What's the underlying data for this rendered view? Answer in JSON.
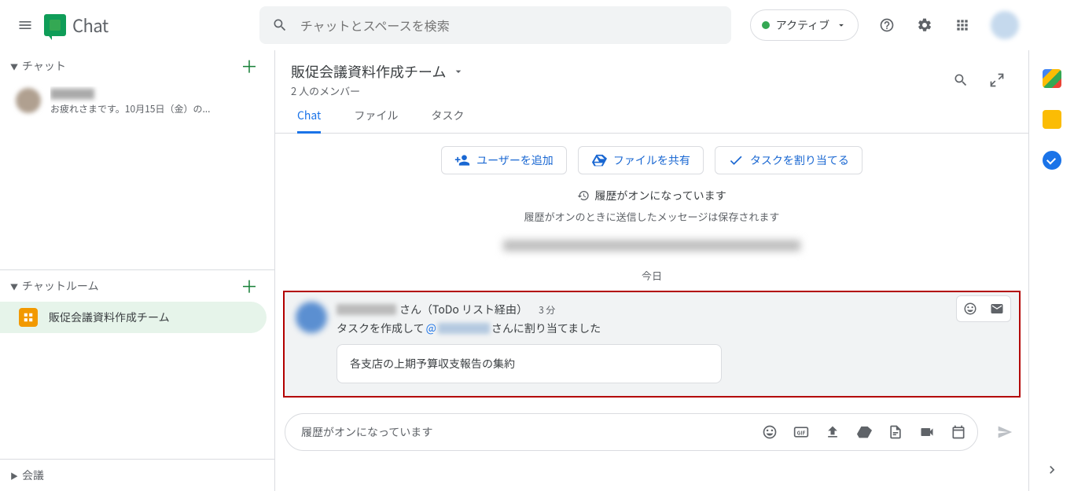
{
  "topbar": {
    "app_title": "Chat",
    "search_placeholder": "チャットとスペースを検索",
    "status_label": "アクティブ"
  },
  "sidebar": {
    "chat_section": "チャット",
    "chat_preview": "お疲れさまです。10月15日（金）の...",
    "room_section": "チャットルーム",
    "selected_room": "販促会議資料作成チーム",
    "meet_section": "会議"
  },
  "room": {
    "title": "販促会議資料作成チーム",
    "member_count": "2 人のメンバー",
    "tabs": {
      "chat": "Chat",
      "files": "ファイル",
      "tasks": "タスク"
    },
    "actions": {
      "add_user": "ユーザーを追加",
      "share_file": "ファイルを共有",
      "assign_task": "タスクを割り当てる"
    },
    "history": {
      "line1": "履歴がオンになっています",
      "line2": "履歴がオンのときに送信したメッセージは保存されます"
    },
    "date_label": "今日"
  },
  "message": {
    "author_suffix": " さん（ToDo リスト経由）",
    "time": "3 分",
    "body_prefix": "タスクを作成して ",
    "body_at": "@",
    "body_suffix": " さんに割り当てました",
    "card_text": "各支店の上期予算収支報告の集約"
  },
  "composer": {
    "placeholder": "履歴がオンになっています"
  }
}
